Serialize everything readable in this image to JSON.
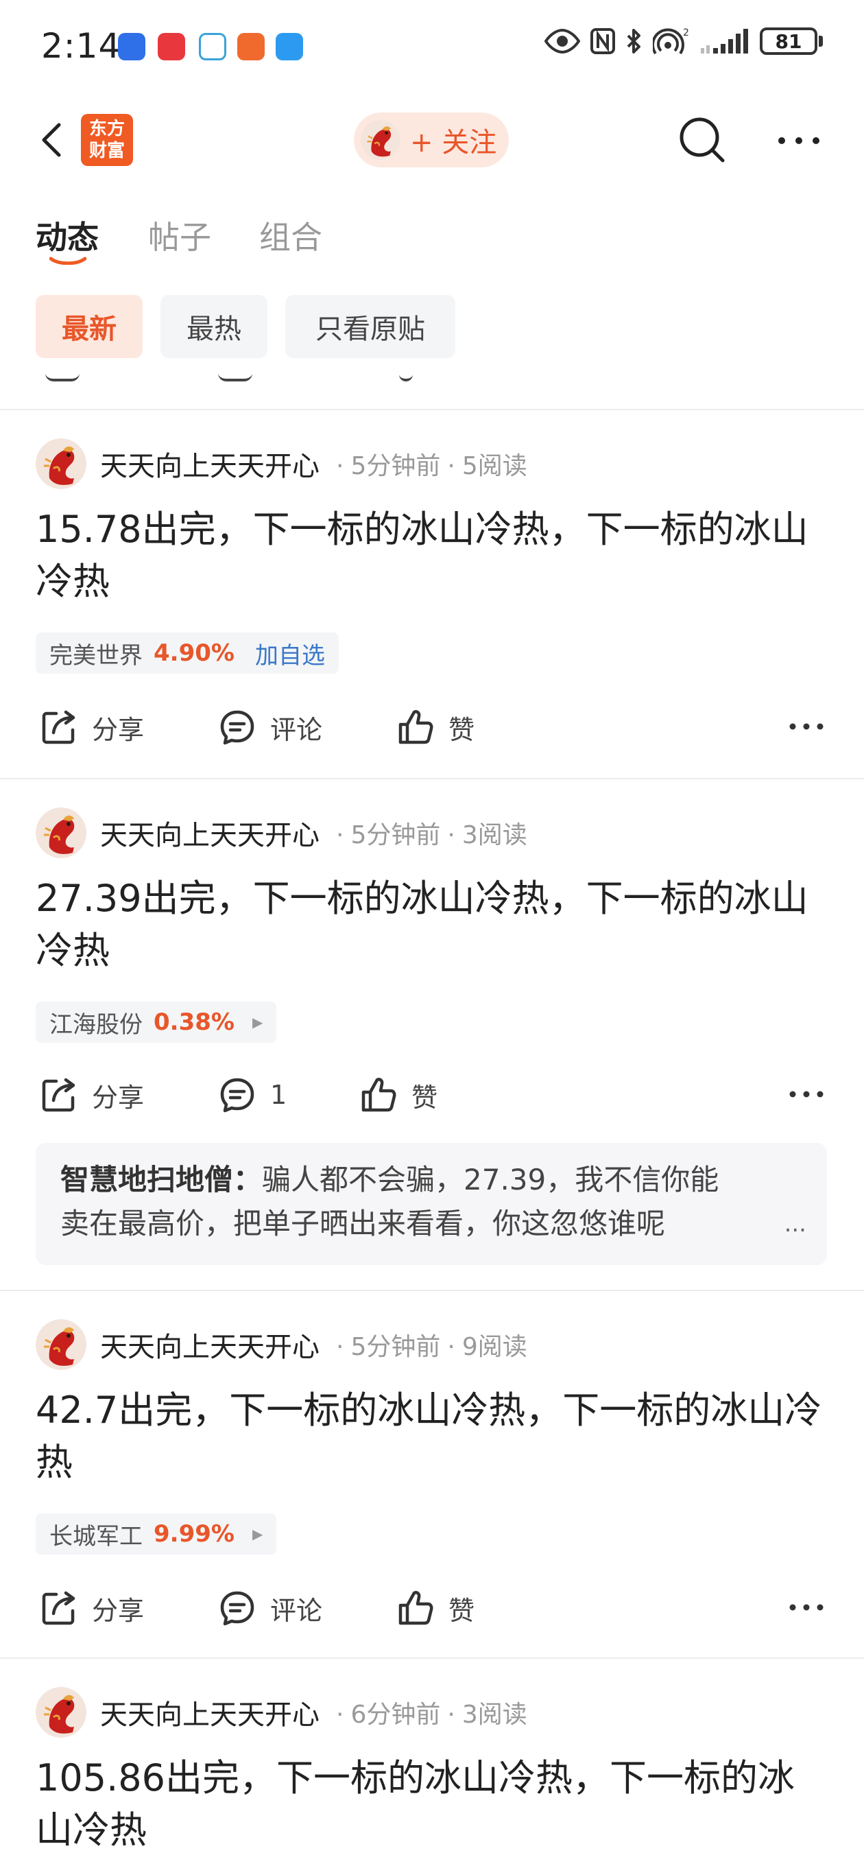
{
  "status_bar": {
    "time": "2:14",
    "battery": "81",
    "signal_label": "2"
  },
  "header": {
    "logo_line1": "东方",
    "logo_line2": "财富",
    "follow_label": "+ 关注"
  },
  "tabs": [
    {
      "label": "动态",
      "active": true
    },
    {
      "label": "帖子",
      "active": false
    },
    {
      "label": "组合",
      "active": false
    }
  ],
  "filters": [
    {
      "label": "最新",
      "active": true
    },
    {
      "label": "最热",
      "active": false
    },
    {
      "label": "只看原贴",
      "active": false
    }
  ],
  "posts": [
    {
      "author": "天天向上天天开心",
      "time": "5分钟前",
      "reads": "5阅读",
      "content": "15.78出完，下一标的冰山冷热，下一标的冰山冷热",
      "stock": {
        "name": "完美世界",
        "change": "4.90%",
        "add": "加自选"
      },
      "actions": {
        "share": "分享",
        "comment": "评论",
        "like": "赞"
      }
    },
    {
      "author": "天天向上天天开心",
      "time": "5分钟前",
      "reads": "3阅读",
      "content": "27.39出完，下一标的冰山冷热，下一标的冰山冷热",
      "stock": {
        "name": "江海股份",
        "change": "0.38%"
      },
      "actions": {
        "share": "分享",
        "comment": "1",
        "like": "赞"
      },
      "top_comment": {
        "user": "智慧地扫地僧：",
        "line1": "骗人都不会骗，27.39，我不信你能",
        "line2": "卖在最高价，把单子晒出来看看，你这忽悠谁呢",
        "more": "..."
      }
    },
    {
      "author": "天天向上天天开心",
      "time": "5分钟前",
      "reads": "9阅读",
      "content": "42.7出完，下一标的冰山冷热，下一标的冰山冷热",
      "stock": {
        "name": "长城军工",
        "change": "9.99%"
      },
      "actions": {
        "share": "分享",
        "comment": "评论",
        "like": "赞"
      }
    },
    {
      "author": "天天向上天天开心",
      "time": "6分钟前",
      "reads": "3阅读",
      "content": "105.86出完，下一标的冰山冷热，下一标的冰山冷热"
    }
  ],
  "colors": {
    "accent": "#e8562a",
    "link": "#3a78c9",
    "chip_active_bg": "#fde8df"
  }
}
